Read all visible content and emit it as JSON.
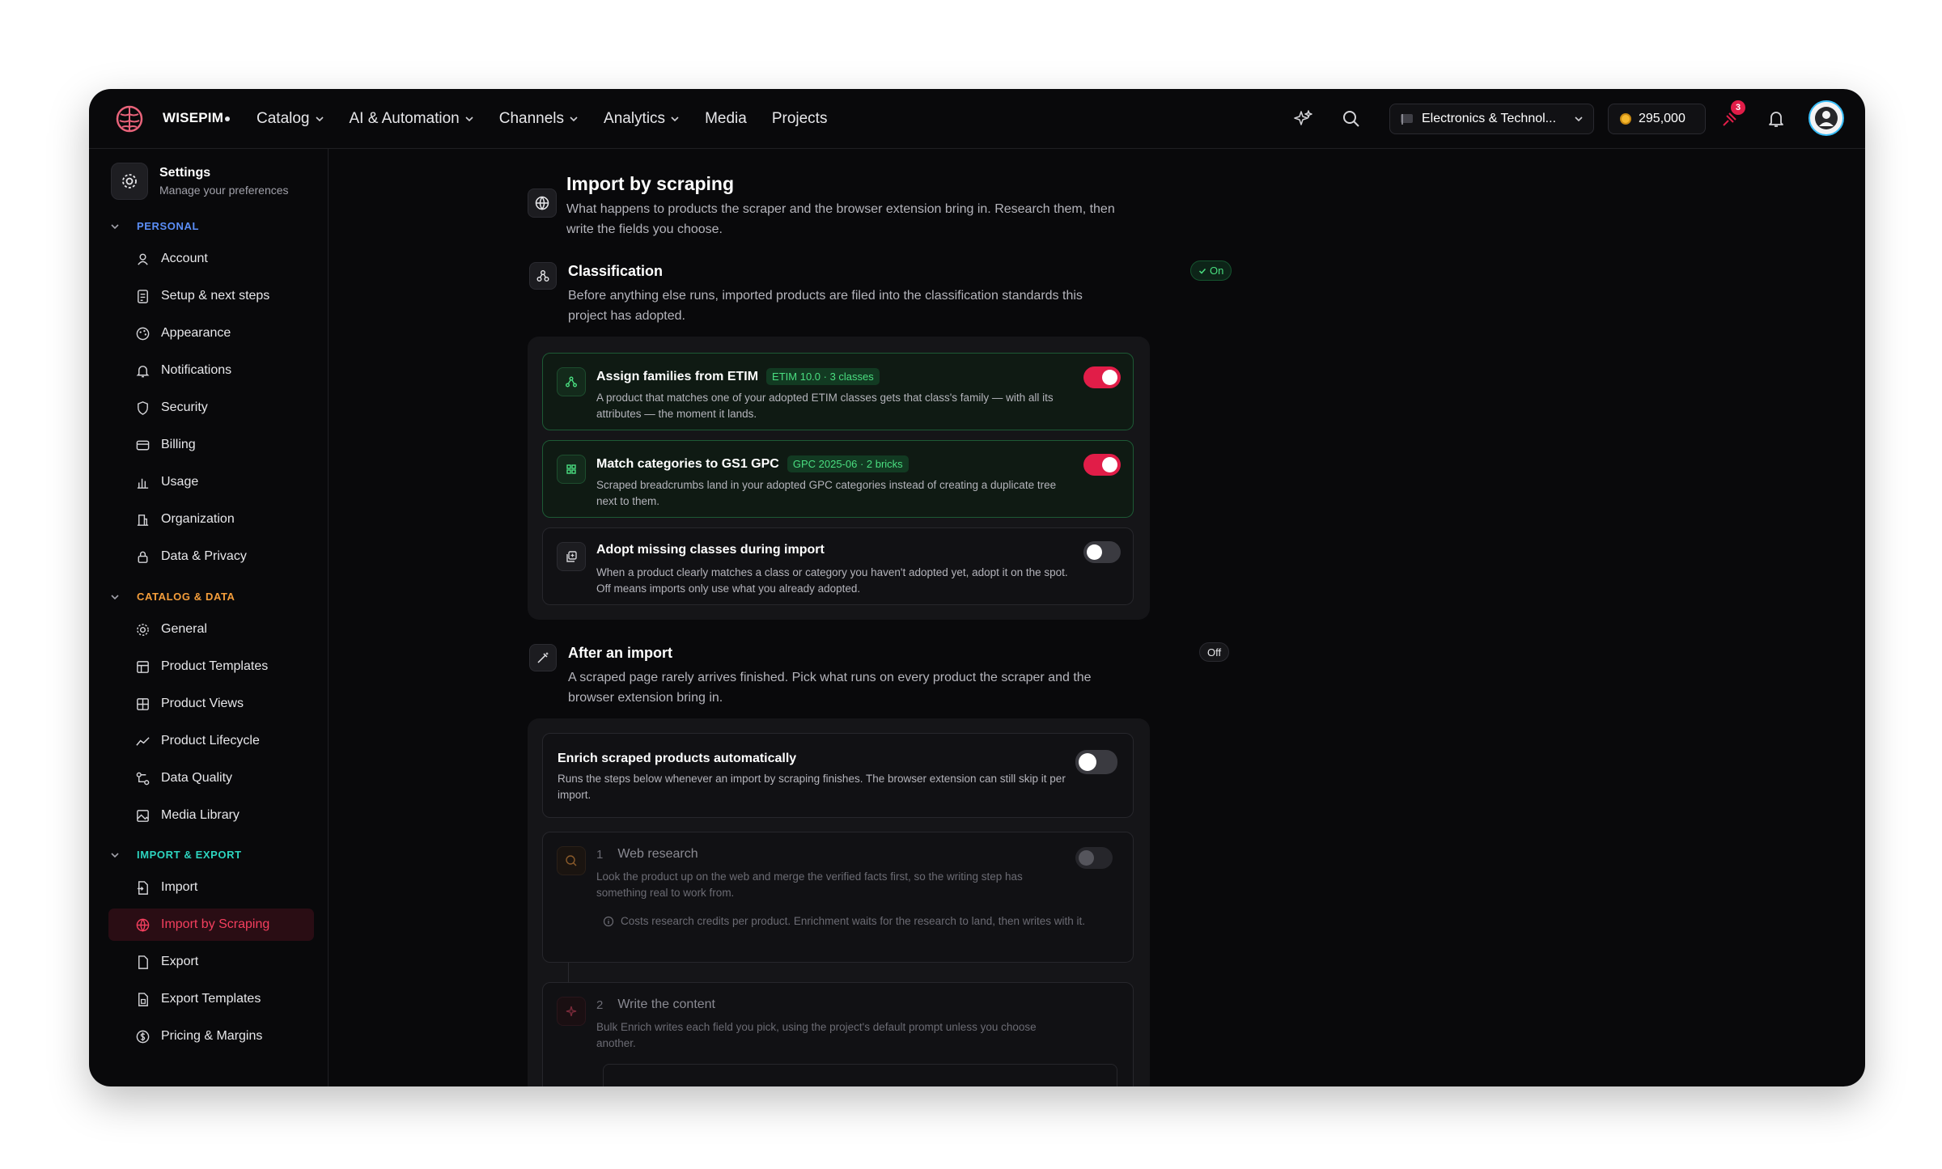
{
  "brand": {
    "name": "WISEPIM"
  },
  "nav": [
    {
      "label": "Catalog",
      "dropdown": true
    },
    {
      "label": "AI & Automation",
      "dropdown": true
    },
    {
      "label": "Channels",
      "dropdown": true
    },
    {
      "label": "Analytics",
      "dropdown": true
    },
    {
      "label": "Media",
      "dropdown": false
    },
    {
      "label": "Projects",
      "dropdown": false
    }
  ],
  "topbar": {
    "project": "Electronics & Technol...",
    "credits": "295,000",
    "notif_count": "3"
  },
  "sidebar": {
    "title": "Settings",
    "subtitle": "Manage your preferences",
    "sections": [
      {
        "label": "PERSONAL",
        "color": "#5b8ef7",
        "items": [
          "Account",
          "Setup & next steps",
          "Appearance",
          "Notifications",
          "Security",
          "Billing",
          "Usage",
          "Organization",
          "Data & Privacy"
        ]
      },
      {
        "label": "CATALOG & DATA",
        "color": "#f59e3b",
        "items": [
          "General",
          "Product Templates",
          "Product Views",
          "Product Lifecycle",
          "Data Quality",
          "Media Library"
        ]
      },
      {
        "label": "IMPORT & EXPORT",
        "color": "#2dd4bf",
        "items": [
          "Import",
          "Import by Scraping",
          "Export",
          "Export Templates",
          "Pricing & Margins"
        ]
      }
    ],
    "active_item": "Import by Scraping"
  },
  "main": {
    "title": "Import by scraping",
    "description": "What happens to products the scraper and the browser extension bring in. Research them, then write the fields you choose.",
    "classification": {
      "title": "Classification",
      "status": "On",
      "description": "Before anything else runs, imported products are filed into the classification standards this project has adopted.",
      "cards": [
        {
          "title": "Assign families from ETIM",
          "tag": "ETIM 10.0 · 3 classes",
          "desc": "A product that matches one of your adopted ETIM classes gets that class's family — with all its attributes — the moment it lands.",
          "enabled": true
        },
        {
          "title": "Match categories to GS1 GPC",
          "tag": "GPC 2025-06 · 2 bricks",
          "desc": "Scraped breadcrumbs land in your adopted GPC categories instead of creating a duplicate tree next to them.",
          "enabled": true
        },
        {
          "title": "Adopt missing classes during import",
          "tag": "",
          "desc": "When a product clearly matches a class or category you haven't adopted yet, adopt it on the spot. Off means imports only use what you already adopted.",
          "enabled": false
        }
      ]
    },
    "after_import": {
      "title": "After an import",
      "status": "Off",
      "description": "A scraped page rarely arrives finished. Pick what runs on every product the scraper and the browser extension bring in.",
      "auto": {
        "title": "Enrich scraped products automatically",
        "desc": "Runs the steps below whenever an import by scraping finishes. The browser extension can still skip it per import.",
        "enabled": false
      },
      "steps": [
        {
          "num": "1",
          "title": "Web research",
          "desc": "Look the product up on the web and merge the verified facts first, so the writing step has something real to work from.",
          "note": "Costs research credits per product. Enrichment waits for the research to land, then writes with it."
        },
        {
          "num": "2",
          "title": "Write the content",
          "desc": "Bulk Enrich writes each field you pick, using the project's default prompt unless you choose another."
        }
      ]
    }
  }
}
